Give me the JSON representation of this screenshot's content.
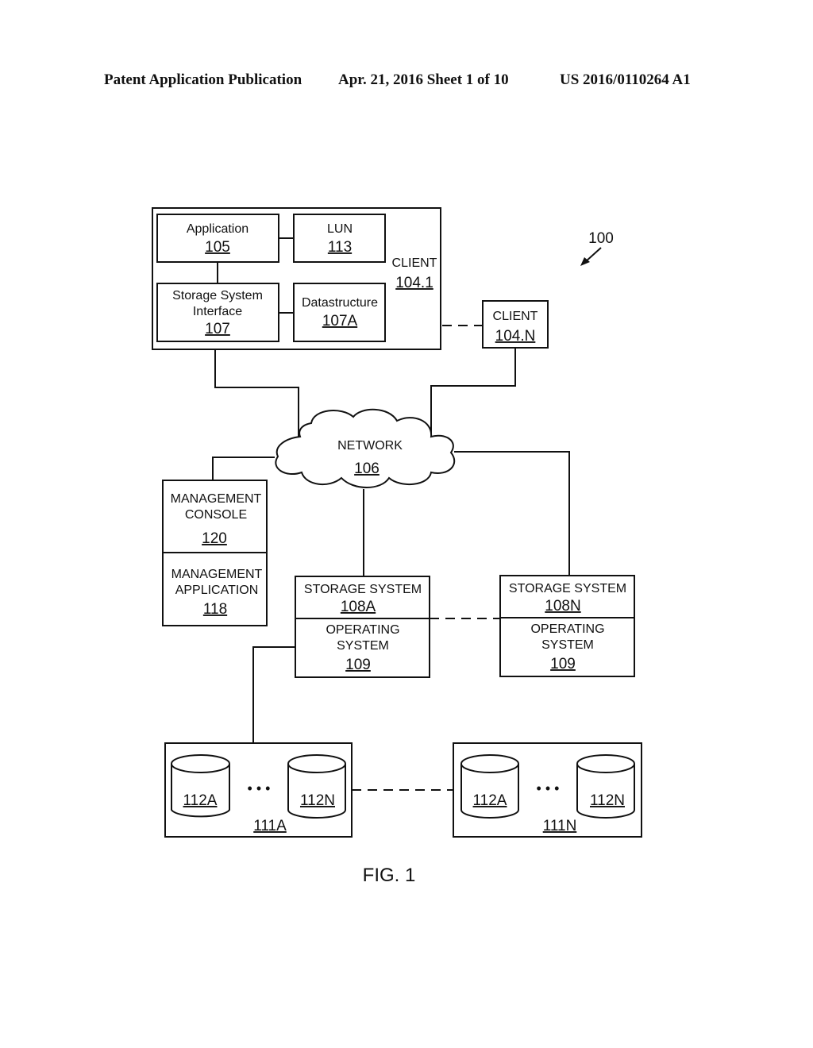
{
  "header": {
    "publication": "Patent Application Publication",
    "date_sheet": "Apr. 21, 2016  Sheet 1 of 10",
    "patent_number": "US 2016/0110264 A1"
  },
  "figure": {
    "ref": "100",
    "caption": "FIG. 1",
    "client1": {
      "label": "CLIENT",
      "num": "104.1",
      "application": {
        "label": "Application",
        "num": "105"
      },
      "lun": {
        "label": "LUN",
        "num": "113"
      },
      "ssi": {
        "label1": "Storage System",
        "label2": "Interface",
        "num": "107"
      },
      "datastructure": {
        "label": "Datastructure",
        "num": "107A"
      }
    },
    "clientN": {
      "label": "CLIENT",
      "num": "104.N"
    },
    "network": {
      "label": "NETWORK",
      "num": "106"
    },
    "mgmt_console": {
      "label1": "MANAGEMENT",
      "label2": "CONSOLE",
      "num": "120"
    },
    "mgmt_app": {
      "label1": "MANAGEMENT",
      "label2": "APPLICATION",
      "num": "118"
    },
    "storageA": {
      "label": "STORAGE SYSTEM",
      "num": "108A",
      "os1": "OPERATING",
      "os2": "SYSTEM",
      "os_num": "109"
    },
    "storageN": {
      "label": "STORAGE SYSTEM",
      "num": "108N",
      "os1": "OPERATING",
      "os2": "SYSTEM",
      "os_num": "109"
    },
    "arrayA": {
      "num": "111A",
      "disk1": "112A",
      "disk2": "112N",
      "ellipsis": "• • •"
    },
    "arrayN": {
      "num": "111N",
      "disk1": "112A",
      "disk2": "112N",
      "ellipsis": "• • •"
    }
  }
}
